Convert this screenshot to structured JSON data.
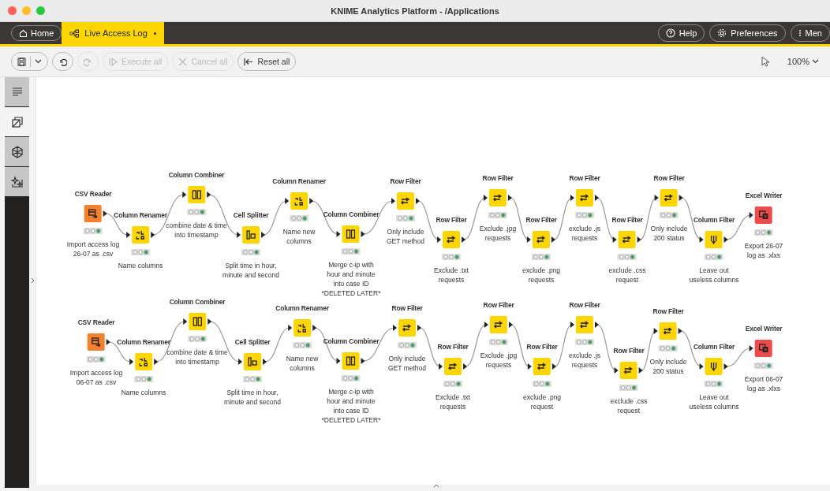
{
  "window": {
    "title": "KNIME Analytics Platform - /Applications"
  },
  "tabs": [
    {
      "label": "Home",
      "kind": "home",
      "selected": false,
      "modified": false
    },
    {
      "label": "Live Access Log",
      "kind": "workflow",
      "selected": true,
      "modified": true
    }
  ],
  "header_buttons": [
    {
      "label": "Help",
      "kind": "help"
    },
    {
      "label": "Preferences",
      "kind": "preferences"
    },
    {
      "label": "Men",
      "kind": "menu"
    }
  ],
  "toolbar": {
    "buttons": [
      {
        "kind": "save",
        "disabled": false
      },
      {
        "kind": "undo",
        "disabled": false
      },
      {
        "kind": "redo",
        "disabled": true
      },
      {
        "kind": "execute",
        "label": "Execute all",
        "disabled": true
      },
      {
        "kind": "cancel",
        "label": "Cancel all",
        "disabled": true
      },
      {
        "kind": "reset",
        "label": "Reset all",
        "disabled": false
      }
    ],
    "zoom": "100%"
  },
  "sidebar": {
    "items": [
      {
        "kind": "description",
        "selected": false
      },
      {
        "kind": "nodes",
        "selected": true
      },
      {
        "kind": "components",
        "selected": false
      },
      {
        "kind": "ai",
        "selected": false
      }
    ]
  },
  "workflows": [
    {
      "nodes": [
        {
          "title": "CSV Reader",
          "kind": "reader",
          "description": "Import access log\n26-07 as .csv",
          "executed": true
        },
        {
          "title": "Column Renamer",
          "kind": "renamer",
          "description": "Name columns",
          "executed": true
        },
        {
          "title": "Column Combiner",
          "kind": "combiner",
          "description": "combine date & time\ninto timestamp",
          "executed": true
        },
        {
          "title": "Cell Splitter",
          "kind": "splitter",
          "description": "Split time in hour,\nminute and second",
          "executed": true
        },
        {
          "title": "Column Renamer",
          "kind": "renamer",
          "description": "Name new\ncolumns",
          "executed": true
        },
        {
          "title": "Column Combiner",
          "kind": "combiner",
          "description": "Merge c-ip with\nhour and minute\ninto case ID\n*DELETED LATER*",
          "executed": true
        },
        {
          "title": "Row Filter",
          "kind": "row_filter",
          "description": "Only include\nGET method",
          "executed": true
        },
        {
          "title": "Row Filter",
          "kind": "row_filter",
          "description": "Exclude .txt\nrequests",
          "executed": true
        },
        {
          "title": "Row Filter",
          "kind": "row_filter",
          "description": "Exclude .jpg\nrequests",
          "executed": true
        },
        {
          "title": "Row Filter",
          "kind": "row_filter",
          "description": "exclude .png\nrequests",
          "executed": true
        },
        {
          "title": "Row Filter",
          "kind": "row_filter",
          "description": "exclude .js\nrequests",
          "executed": true
        },
        {
          "title": "Row Filter",
          "kind": "row_filter",
          "description": "exclude .css\nrequest",
          "executed": true
        },
        {
          "title": "Row Filter",
          "kind": "row_filter",
          "description": "Only include\n200 status",
          "executed": true
        },
        {
          "title": "Column Filter",
          "kind": "column_filter",
          "description": "Leave out\nuseless columns",
          "executed": true
        },
        {
          "title": "Excel Writer",
          "kind": "writer",
          "description": "Export 26-07\nlog as .xlxs",
          "executed": true
        }
      ]
    },
    {
      "nodes": [
        {
          "title": "CSV Reader",
          "kind": "reader",
          "description": "Import access log\n06-07 as .csv",
          "executed": true
        },
        {
          "title": "Column Renamer",
          "kind": "renamer",
          "description": "Name columns",
          "executed": true
        },
        {
          "title": "Column Combiner",
          "kind": "combiner",
          "description": "combine date & time\ninto timestamp",
          "executed": true
        },
        {
          "title": "Cell Splitter",
          "kind": "splitter",
          "description": "Split time in hour,\nminute and second",
          "executed": true
        },
        {
          "title": "Column Renamer",
          "kind": "renamer",
          "description": "Name new\ncolumns",
          "executed": true
        },
        {
          "title": "Column Combiner",
          "kind": "combiner",
          "description": "Merge c-ip with\nhour and minute\ninto case ID\n*DELETED LATER*",
          "executed": true
        },
        {
          "title": "Row Filter",
          "kind": "row_filter",
          "description": "Only include\nGET method",
          "executed": true
        },
        {
          "title": "Row Filter",
          "kind": "row_filter",
          "description": "Exclude .txt\nrequests",
          "executed": true
        },
        {
          "title": "Row Filter",
          "kind": "row_filter",
          "description": "Exclude .jpg\nrequests",
          "executed": true
        },
        {
          "title": "Row Filter",
          "kind": "row_filter",
          "description": "exclude .png\nrequest",
          "executed": true
        },
        {
          "title": "Row Filter",
          "kind": "row_filter",
          "description": "exclude .js\nrequests",
          "executed": true
        },
        {
          "title": "Row Filter",
          "kind": "row_filter",
          "description": "exclude .css\nrequest",
          "executed": true
        },
        {
          "title": "Row Filter",
          "kind": "row_filter",
          "description": "Only include\n200 status",
          "executed": true
        },
        {
          "title": "Column Filter",
          "kind": "column_filter",
          "description": "Leave out\nuseless columns",
          "executed": true
        },
        {
          "title": "Excel Writer",
          "kind": "writer",
          "description": "Export 06-07\nlog as .xlxs",
          "executed": true
        }
      ]
    }
  ]
}
